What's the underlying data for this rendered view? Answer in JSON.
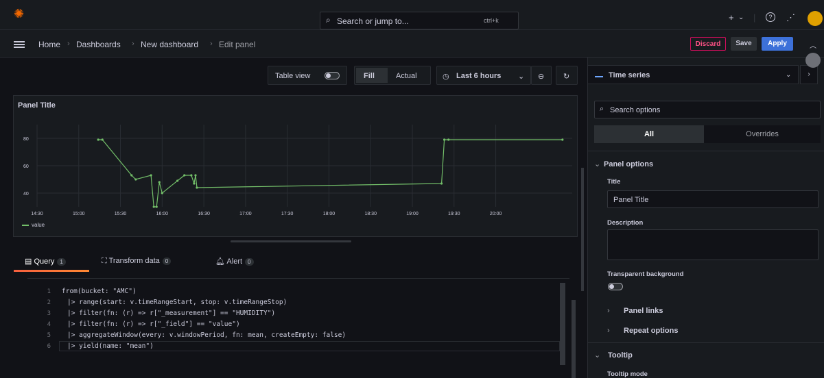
{
  "topbar": {
    "search_placeholder": "Search or jump to...",
    "search_shortcut": "ctrl+k",
    "plus": "+",
    "caret": "⌄",
    "help_icon": "?",
    "rss_icon": "⋰"
  },
  "breadcrumb": {
    "items": [
      "Home",
      "Dashboards",
      "New dashboard",
      "Edit panel"
    ]
  },
  "actions": {
    "discard": "Discard",
    "save": "Save",
    "apply": "Apply"
  },
  "toolbar": {
    "table_view": "Table view",
    "fill": "Fill",
    "actual": "Actual",
    "time_range": "Last 6 hours"
  },
  "panel": {
    "title": "Panel Title",
    "legend": "value"
  },
  "chart_data": {
    "type": "line",
    "title": "Panel Title",
    "x_ticks": [
      "14:30",
      "15:00",
      "15:30",
      "16:00",
      "16:30",
      "17:00",
      "17:30",
      "18:00",
      "18:30",
      "19:00",
      "19:30",
      "20:00"
    ],
    "y_ticks": [
      40,
      60,
      80
    ],
    "ylim": [
      30,
      90
    ],
    "series": [
      {
        "name": "value",
        "x": [
          "15:14",
          "15:17",
          "15:38",
          "15:41",
          "15:52",
          "15:54",
          "15:56",
          "15:58",
          "16:00",
          "16:11",
          "16:16",
          "16:21",
          "16:23",
          "16:24",
          "16:25",
          "19:21",
          "19:23",
          "19:26",
          "20:48"
        ],
        "y": [
          79,
          79,
          53,
          50,
          53,
          30,
          30,
          48,
          40,
          49,
          53,
          53,
          47,
          53,
          44,
          47,
          79,
          79,
          79
        ]
      }
    ],
    "color": "#73bf69",
    "grid": true,
    "legend": "bottom-left"
  },
  "query_tabs": [
    {
      "label": "Query",
      "count": "1"
    },
    {
      "label": "Transform data",
      "count": "0"
    },
    {
      "label": "Alert",
      "count": "0"
    }
  ],
  "code": {
    "line_numbers": [
      "1",
      "2",
      "3",
      "4",
      "5",
      "6"
    ],
    "l1": "from(bucket: \"AMC\")",
    "l2": "|> range(start: v.timeRangeStart, stop: v.timeRangeStop)",
    "l3": "|> filter(fn: (r) => r[\"_measurement\"] == \"HUMIDITY\")",
    "l4": "|> filter(fn: (r) => r[\"_field\"] == \"value\")",
    "l5": "|> aggregateWindow(every: v.windowPeriod, fn: mean, createEmpty: false)",
    "l6": "|> yield(name: \"mean\")"
  },
  "options": {
    "viz": "Time series",
    "search_placeholder": "Search options",
    "tab_all": "All",
    "tab_overrides": "Overrides",
    "panel_options": "Panel options",
    "title_label": "Title",
    "title_value": "Panel Title",
    "description_label": "Description",
    "transparent_label": "Transparent background",
    "panel_links": "Panel links",
    "repeat_options": "Repeat options",
    "tooltip": "Tooltip",
    "tooltip_mode": "Tooltip mode"
  },
  "colors": {
    "accent": "#3d71d9",
    "series": "#73bf69",
    "discard": "#d10e5c"
  }
}
